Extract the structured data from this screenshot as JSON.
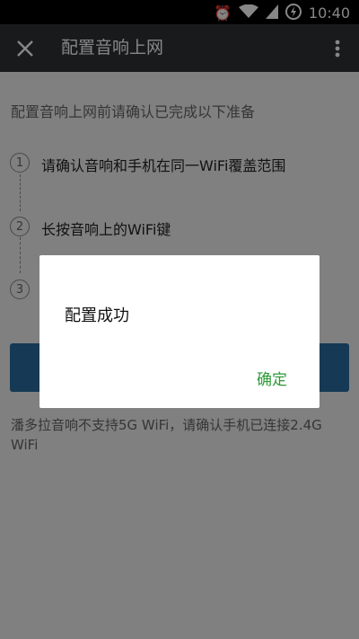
{
  "status": {
    "time": "10:40"
  },
  "appbar": {
    "title": "配置音响上网"
  },
  "content": {
    "intro": "配置音响上网前请确认已完成以下准备",
    "steps": [
      {
        "num": "1",
        "text": "请确认音响和手机在同一WiFi覆盖范围"
      },
      {
        "num": "2",
        "text": "长按音响上的WiFi键"
      },
      {
        "num": "3",
        "text": ""
      }
    ],
    "note": "潘多拉音响不支持5G WiFi，请确认手机已连接2.4G WiFi"
  },
  "dialog": {
    "message": "配置成功",
    "confirm": "确定"
  },
  "colors": {
    "appbar": "#2e3236",
    "primary_button": "#2b6fa3",
    "confirm_text": "#2e9a36"
  }
}
